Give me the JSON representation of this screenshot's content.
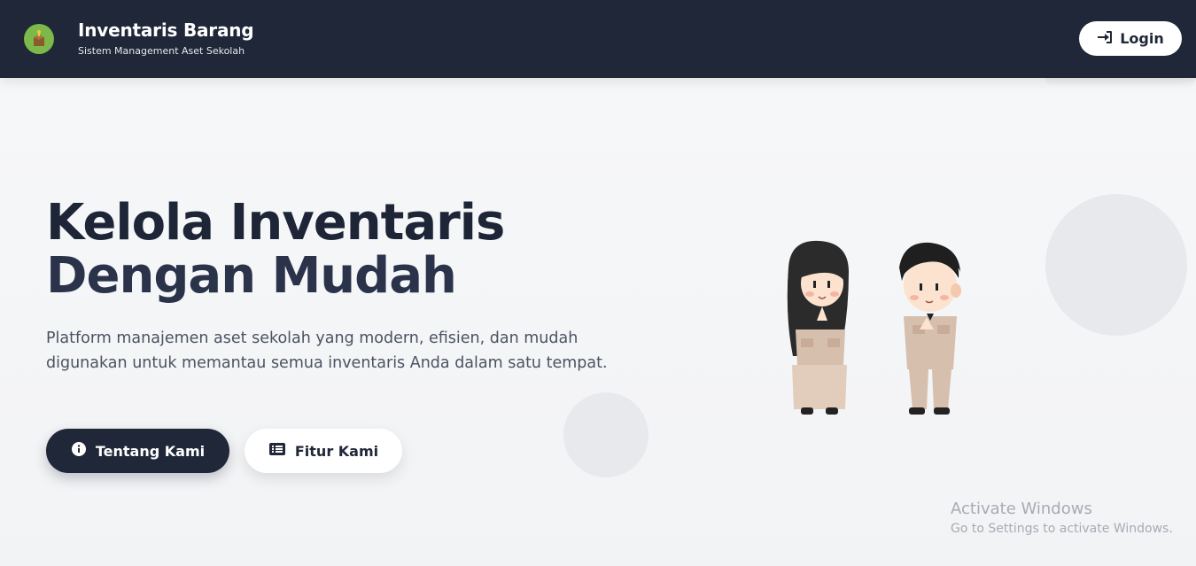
{
  "header": {
    "title": "Inventaris Barang",
    "subtitle": "Sistem Management Aset Sekolah",
    "logo_icon": "box-icon",
    "login_label": "Login",
    "login_icon": "sign-in-icon",
    "bg_color": "#1f2738"
  },
  "hero": {
    "title_line1": "Kelola Inventaris",
    "title_line2": "Dengan Mudah",
    "description": "Platform manajemen aset sekolah yang modern, efisien, dan mudah digunakan untuk memantau semua inventaris Anda dalam satu tempat.",
    "buttons": {
      "about": {
        "label": "Tentang Kami",
        "icon": "info-icon"
      },
      "features": {
        "label": "Fitur Kami",
        "icon": "list-icon"
      }
    },
    "illustration": "school-staff-greeting-illustration"
  },
  "watermark": {
    "title": "Activate Windows",
    "subtitle": "Go to Settings to activate Windows."
  },
  "colors": {
    "primary": "#1f2738",
    "background": "#f5f6f8",
    "text_muted": "#4b5262"
  }
}
